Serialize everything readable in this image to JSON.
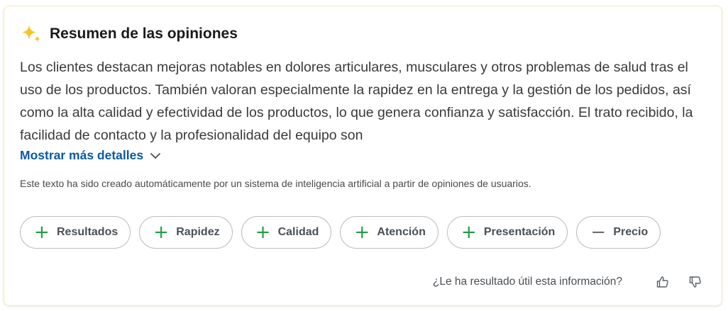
{
  "header": {
    "icon": "sparkle-icon",
    "title": "Resumen de las opiniones"
  },
  "summary": {
    "text": "Los clientes destacan mejoras notables en dolores articulares, musculares y otros problemas de salud tras el uso de los productos. También valoran especialmente la rapidez en la entrega y la gestión de los pedidos, así como la alta calidad y efectividad de los productos, lo que genera confianza y satisfacción. El trato recibido, la facilidad de contacto y la profesionalidad del equipo son"
  },
  "more_link": {
    "label": "Mostrar más detalles",
    "icon": "chevron-down-icon"
  },
  "disclaimer": "Este texto ha sido creado automáticamente por un sistema de inteligencia artificial a partir de opiniones de usuarios.",
  "tags": [
    {
      "label": "Resultados",
      "sign": "+",
      "icon": "plus-icon"
    },
    {
      "label": "Rapidez",
      "sign": "+",
      "icon": "plus-icon"
    },
    {
      "label": "Calidad",
      "sign": "+",
      "icon": "plus-icon"
    },
    {
      "label": "Atención",
      "sign": "+",
      "icon": "plus-icon"
    },
    {
      "label": "Presentación",
      "sign": "+",
      "icon": "plus-icon"
    },
    {
      "label": "Precio",
      "sign": "−",
      "icon": "minus-icon"
    }
  ],
  "feedback": {
    "question": "¿Le ha resultado útil esta información?",
    "like_icon": "thumbs-up-icon",
    "dislike_icon": "thumbs-down-icon"
  },
  "colors": {
    "accent_link": "#0a5aa3",
    "positive": "#1f9d45",
    "negative": "#6b7075",
    "sparkle": "#f6c521",
    "card_border": "#f3e7b8"
  }
}
